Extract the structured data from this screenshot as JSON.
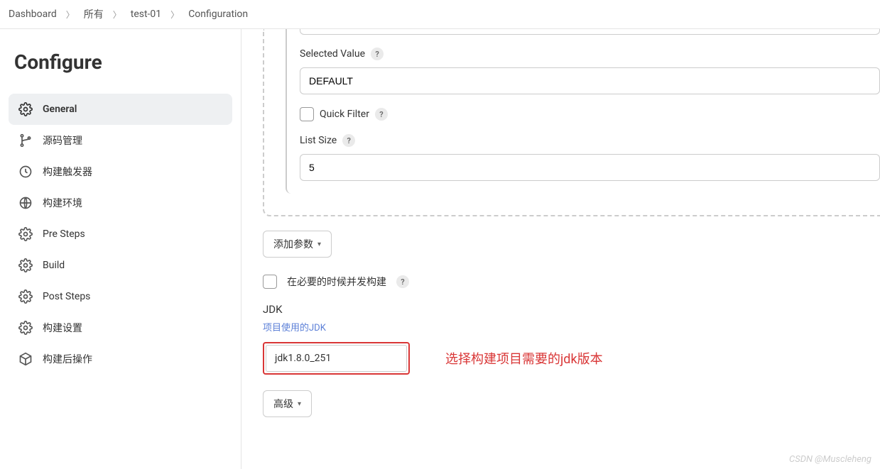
{
  "breadcrumb": {
    "items": [
      "Dashboard",
      "所有",
      "test-01",
      "Configuration"
    ]
  },
  "page_title": "Configure",
  "sidebar": {
    "items": [
      {
        "label": "General"
      },
      {
        "label": "源码管理"
      },
      {
        "label": "构建触发器"
      },
      {
        "label": "构建环境"
      },
      {
        "label": "Pre Steps"
      },
      {
        "label": "Build"
      },
      {
        "label": "Post Steps"
      },
      {
        "label": "构建设置"
      },
      {
        "label": "构建后操作"
      }
    ]
  },
  "form": {
    "selected_value_label": "Selected Value",
    "selected_value": "DEFAULT",
    "quick_filter_label": "Quick Filter",
    "list_size_label": "List Size",
    "list_size_value": "5",
    "add_param_label": "添加参数",
    "concurrent_label": "在必要的时候并发构建",
    "jdk_label": "JDK",
    "jdk_sub": "项目使用的JDK",
    "jdk_value": "jdk1.8.0_251",
    "advanced_label": "高级"
  },
  "annotation": "选择构建项目需要的jdk版本",
  "watermark": "CSDN @Muscleheng"
}
